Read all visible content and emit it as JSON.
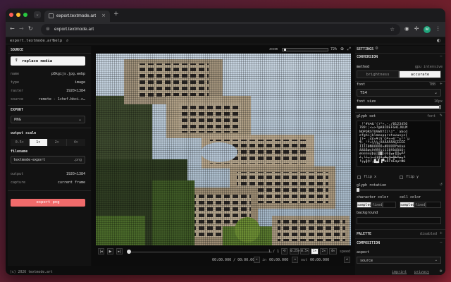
{
  "browser": {
    "tab_title": "export.textmode.art",
    "tab_close": "×",
    "new_tab": "+",
    "url": "export.textmode.art",
    "profile_initial": "M"
  },
  "appbar": {
    "brand": "export.textmode.art",
    "help": "help"
  },
  "left": {
    "source_title": "SOURCE",
    "replace_label": "replace media",
    "info": [
      {
        "key": "name",
        "value": "p8kgijs.jpg.webp"
      },
      {
        "key": "type",
        "value": "image"
      },
      {
        "key": "raster",
        "value": "1920×1384"
      },
      {
        "key": "source",
        "value": "remote - 1chef.bbci.c…"
      }
    ],
    "export_title": "EXPORT",
    "format": "PNG",
    "output_scale_label": "output scale",
    "scales": [
      "0.5×",
      "1×",
      "2×",
      "4×"
    ],
    "active_scale": 1,
    "filename_label": "filename",
    "filename": "textmode-export",
    "filename_ext": ".png",
    "output": [
      {
        "key": "output",
        "value": "1920×1384"
      },
      {
        "key": "capture",
        "value": "current frame"
      }
    ],
    "export_button": "export png"
  },
  "center": {
    "zoom_label": "zoom",
    "zoom_value": "72%",
    "zoom_level": 0.72,
    "page": "1 / 1",
    "speeds": [
      "0.25×",
      "0.5×",
      "1×",
      "2×",
      "4×"
    ],
    "active_speed": 2,
    "speed_label": "speed",
    "time_range": "00:00.000 / 00:00.000",
    "in_label": "in",
    "in_value": "00:00.000",
    "out_label": "out",
    "out_value": "00:00.000"
  },
  "right": {
    "settings_title": "SETTINGS",
    "conversion_title": "CONVERSION",
    "method_label": "method",
    "method_note": "gpu intensive",
    "methods": [
      "brightness",
      "accurate"
    ],
    "active_method": 1,
    "font_label": "font",
    "font_meta": "TBB",
    "font_value": "TS4",
    "font_size_label": "font size",
    "font_size_value": "16px",
    "glyph_set_label": "glyph set",
    "glyph_set_meta": "font",
    "glyph_lines": [
      " !\"#$%&'()*+,-./0123456",
      "789:;<=>?@ABCDEFGHIJKLM",
      "NOPQRSTUVWXYZ[\\]^_`abcd",
      "efghijklmnopqrstuvwxyz{",
      "|}~ ¡¢£¤¥¦§¨©ª«¬­®¯°±²³´µ",
      "¶·¸¹º»¼½¾¿ÀÁÂÃÄÅÆÇÈÉÊË",
      "ÌÍÎÏÐÑÒÓÔÕÖ×ØÙÚÛÜÝÞßàá",
      "âãäåæçèéêëìíîïðñòóôõö÷",
      "øùúûüýþÿ░▒▓│┤╡╢╖╕╣║╗╝╜",
      "╛┐└┴┬├─┼╞╟╚╔╩╦╠═╬╧╨╤╥╙",
      "╘╒╓╫╪┘┌█▄▌▐▀αßΓπΣσµτΦΘ"
    ],
    "flip_x": "flip x",
    "flip_y": "flip y",
    "glyph_rotation_label": "glyph rotation",
    "character_color_label": "character color",
    "cell_color_label": "cell color",
    "color_modes": [
      "sampled",
      "fixed"
    ],
    "background_label": "background",
    "palette_title": "PALETTE",
    "palette_state": "disabled",
    "composition_title": "COMPOSITION",
    "aspect_label": "aspect",
    "aspect_value": "source"
  },
  "footer": {
    "copyright": "(c) 2026 textmode.art",
    "imprint": "imprint",
    "privacy": "privacy"
  }
}
